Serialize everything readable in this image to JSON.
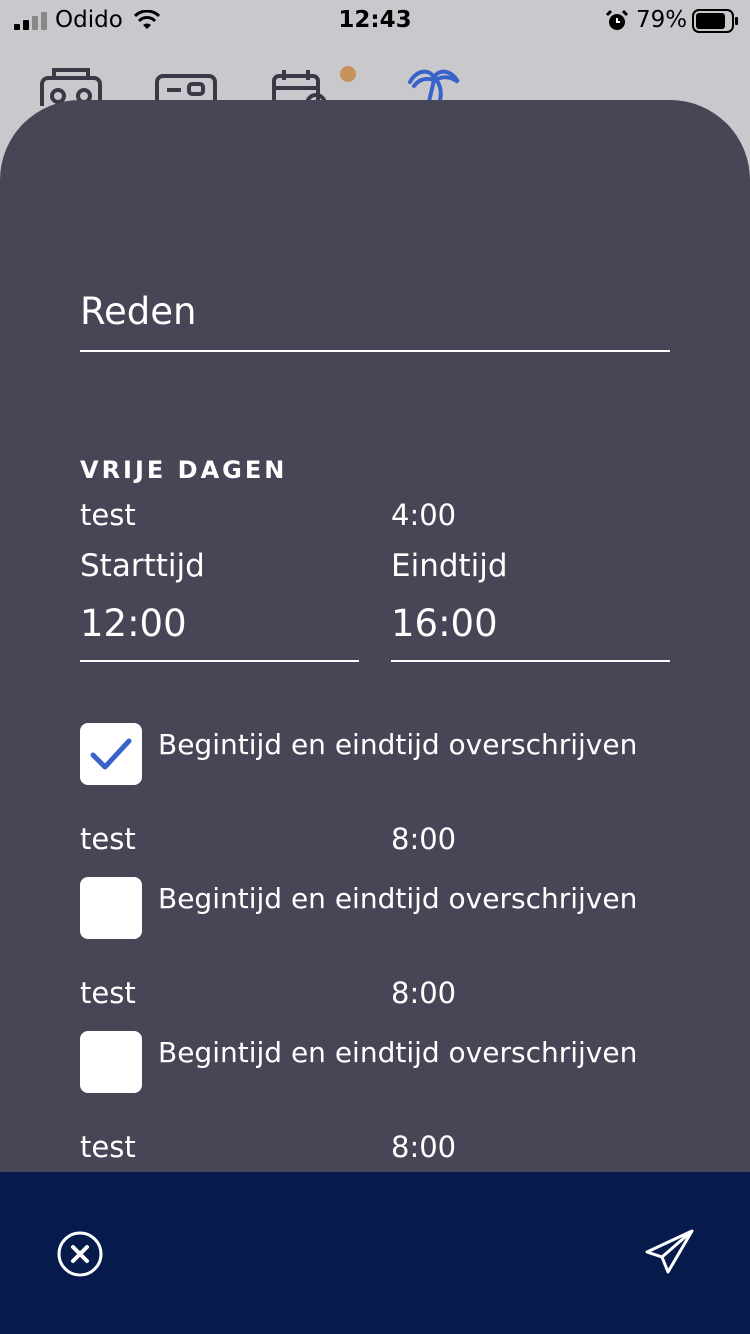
{
  "status_bar": {
    "carrier": "Odido",
    "time": "12:43",
    "battery_percent": "79%",
    "icons": [
      "signal-icon",
      "wifi-icon",
      "alarm-icon",
      "battery-icon"
    ]
  },
  "background_tabs": {
    "icons": [
      "radio-icon",
      "card-icon",
      "calendar-icon",
      "palm-tree-icon"
    ],
    "notification_dot_color": "#c8935a",
    "active_icon_color": "#3a63c9"
  },
  "form": {
    "reason_placeholder": "Reden",
    "section_title": "VRIJE DAGEN",
    "first_day": {
      "name": "test",
      "hours": "4:00",
      "start_label": "Starttijd",
      "end_label": "Eindtijd",
      "start_value": "12:00",
      "end_value": "16:00",
      "override_label": "Begintijd en eindtijd overschrijven",
      "override_checked": true
    },
    "days": [
      {
        "name": "test",
        "hours": "8:00",
        "override_label": "Begintijd en eindtijd overschrijven",
        "override_checked": false
      },
      {
        "name": "test",
        "hours": "8:00",
        "override_label": "Begintijd en eindtijd overschrijven",
        "override_checked": false
      },
      {
        "name": "test",
        "hours": "8:00"
      }
    ]
  },
  "colors": {
    "sheet": "#474656",
    "bottom_bar": "#061a4c",
    "checkmark": "#3a63c9"
  },
  "actions": {
    "icons": [
      "close-circle-icon",
      "send-icon"
    ]
  }
}
